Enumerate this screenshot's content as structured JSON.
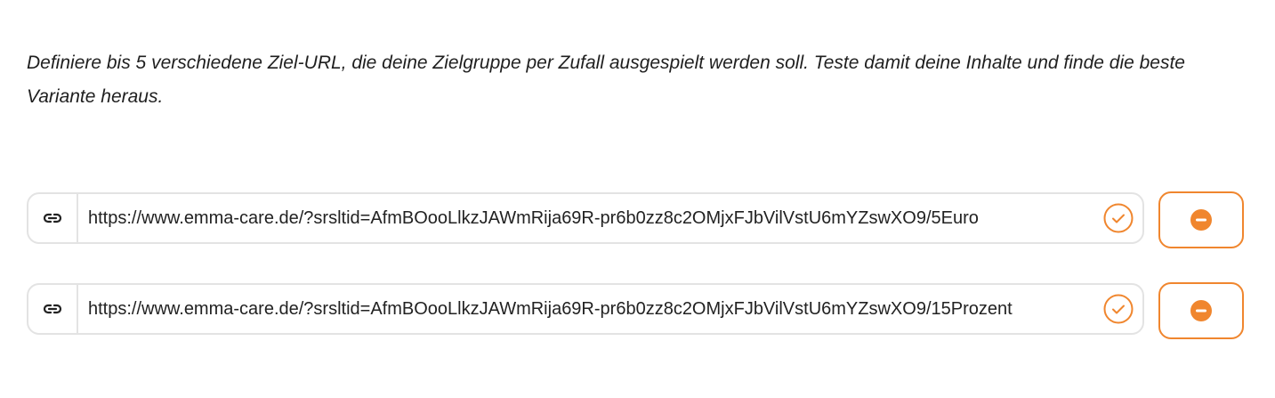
{
  "description": "Definiere bis 5 verschiedene Ziel-URL, die deine Zielgruppe per Zufall ausgespielt werden soll. Teste damit deine Inhalte und finde die beste Variante heraus.",
  "accent_color": "#f0862e",
  "border_color": "#e3e3e3",
  "url_rows": [
    {
      "url": "https://www.emma-care.de/?srsltid=AfmBOooLlkzJAWmRija69R-pr6b0zz8c2OMjxFJbVilVstU6mYZswXO9/5Euro",
      "leading_icon": "link-icon",
      "status_icon": "check-circle-icon",
      "action_icon": "minus-circle-icon"
    },
    {
      "url": "https://www.emma-care.de/?srsltid=AfmBOooLlkzJAWmRija69R-pr6b0zz8c2OMjxFJbVilVstU6mYZswXO9/15Prozent",
      "leading_icon": "link-icon",
      "status_icon": "check-circle-icon",
      "action_icon": "minus-circle-icon"
    }
  ]
}
